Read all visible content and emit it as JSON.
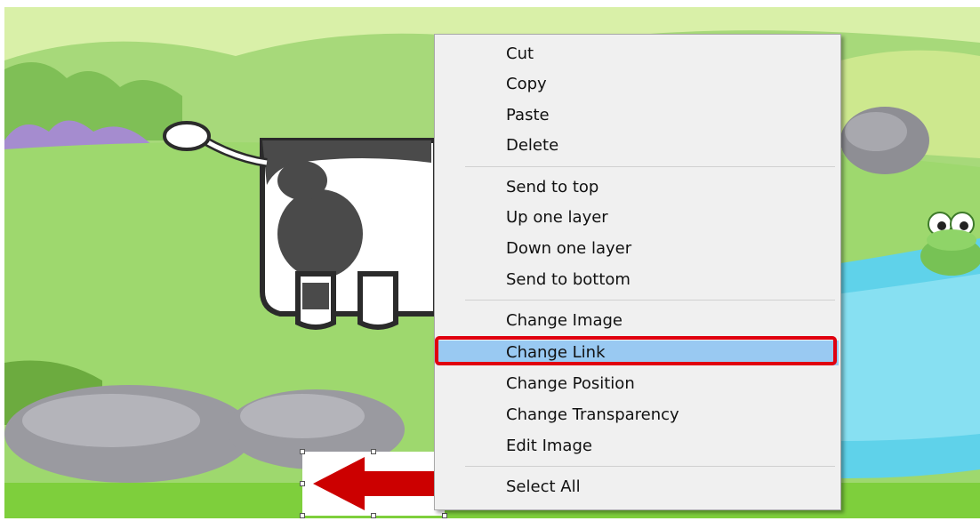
{
  "context_menu": {
    "groups": [
      [
        "Cut",
        "Copy",
        "Paste",
        "Delete"
      ],
      [
        "Send to top",
        "Up one layer",
        "Down one layer",
        "Send to bottom"
      ],
      [
        "Change Image",
        "Change Link",
        "Change Position",
        "Change Transparency",
        "Edit Image"
      ],
      [
        "Select All"
      ]
    ],
    "hovered_item": "Change Link"
  },
  "scene": {
    "characters": [
      "cow",
      "frog"
    ],
    "selected_image": "red-arrow-left-icon"
  },
  "colors": {
    "highlight": "#e0000f",
    "menu_hover": "#99c9f2",
    "menu_bg": "#f0f0f0",
    "arrow": "#cc0000"
  }
}
